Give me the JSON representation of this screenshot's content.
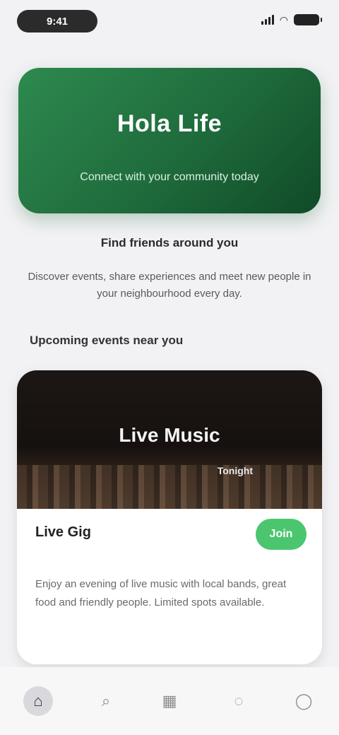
{
  "status_bar": {
    "time": "9:41",
    "icons": [
      "signal-icon",
      "wifi-icon",
      "battery-icon"
    ]
  },
  "hero": {
    "title": "Hola Life",
    "subtitle": "Connect with your community today",
    "caption": "Find friends around you",
    "intro": "Discover events, share experiences and meet new people in your neighbourhood every day."
  },
  "section": {
    "heading": "Upcoming events near you"
  },
  "event": {
    "image_title": "Live Music",
    "image_tag": "Tonight",
    "name": "Live Gig",
    "join_label": "Join",
    "description": "Enjoy an evening of live music with local bands, great food and friendly people. Limited spots available."
  },
  "tab_bar": {
    "tabs": [
      {
        "icon": "home-icon",
        "glyph": "⌂",
        "active": true
      },
      {
        "icon": "search-icon",
        "glyph": "⌕",
        "active": false
      },
      {
        "icon": "calendar-icon",
        "glyph": "▦",
        "active": false
      },
      {
        "icon": "chat-icon",
        "glyph": "◌",
        "active": false
      },
      {
        "icon": "profile-icon",
        "glyph": "◯",
        "active": false
      }
    ]
  },
  "colors": {
    "accent_green": "#4cc66e",
    "hero_green": "#1f6b3c",
    "background": "#f2f2f4"
  }
}
